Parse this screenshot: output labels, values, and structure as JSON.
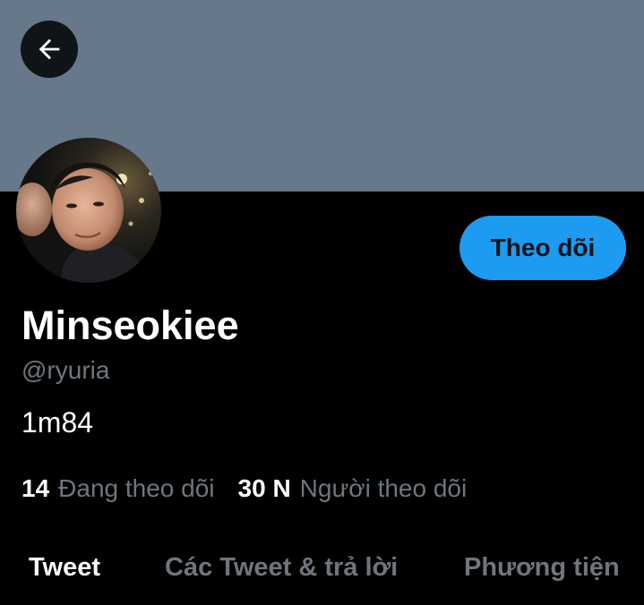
{
  "header": {
    "back_icon": "arrow-left-icon",
    "banner_color": "#66788a"
  },
  "profile": {
    "display_name": "Minseokiee",
    "handle": "@ryuria",
    "bio": "1m84",
    "follow_label": "Theo dõi",
    "follow_color": "#1d9bf0"
  },
  "stats": {
    "following_count": "14",
    "following_label": "Đang theo dõi",
    "followers_count": "30 N",
    "followers_label": "Người theo dõi"
  },
  "tabs": [
    {
      "label": "Tweet",
      "active": true
    },
    {
      "label": "Các Tweet & trả lời",
      "active": false
    },
    {
      "label": "Phương tiện",
      "active": false
    }
  ]
}
